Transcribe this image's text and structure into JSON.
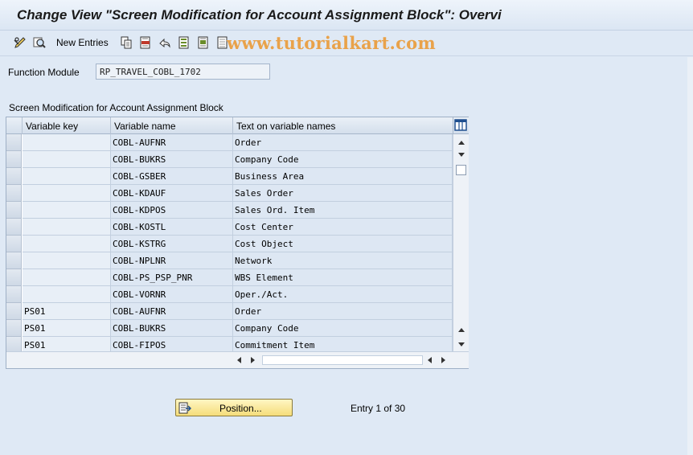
{
  "window": {
    "title": "Change View \"Screen Modification for Account Assignment Block\": Overvi"
  },
  "toolbar": {
    "new_entries_label": "New Entries",
    "watermark": "www.tutorialkart.com",
    "icons": [
      "display-change-icon",
      "find-icon",
      "copy-icon",
      "delete-icon",
      "undo-icon",
      "select-all-icon",
      "select-block-icon",
      "deselect-all-icon"
    ]
  },
  "form": {
    "function_module_label": "Function Module",
    "function_module_value": "RP_TRAVEL_COBL_1702"
  },
  "table": {
    "title": "Screen Modification for Account Assignment Block",
    "columns": [
      "Variable key",
      "Variable name",
      "Text on variable names"
    ],
    "rows": [
      {
        "key": "",
        "name": "COBL-AUFNR",
        "text": "Order"
      },
      {
        "key": "",
        "name": "COBL-BUKRS",
        "text": "Company Code"
      },
      {
        "key": "",
        "name": "COBL-GSBER",
        "text": "Business Area"
      },
      {
        "key": "",
        "name": "COBL-KDAUF",
        "text": "Sales Order"
      },
      {
        "key": "",
        "name": "COBL-KDPOS",
        "text": "Sales Ord. Item"
      },
      {
        "key": "",
        "name": "COBL-KOSTL",
        "text": "Cost Center"
      },
      {
        "key": "",
        "name": "COBL-KSTRG",
        "text": "Cost Object"
      },
      {
        "key": "",
        "name": "COBL-NPLNR",
        "text": "Network"
      },
      {
        "key": "",
        "name": "COBL-PS_PSP_PNR",
        "text": "WBS Element"
      },
      {
        "key": "",
        "name": "COBL-VORNR",
        "text": "Oper./Act."
      },
      {
        "key": "PS01",
        "name": "COBL-AUFNR",
        "text": "Order"
      },
      {
        "key": "PS01",
        "name": "COBL-BUKRS",
        "text": "Company Code"
      },
      {
        "key": "PS01",
        "name": "COBL-FIPOS",
        "text": "Commitment Item"
      }
    ]
  },
  "footer": {
    "position_button_label": "Position...",
    "entry_text": "Entry 1 of 30"
  }
}
